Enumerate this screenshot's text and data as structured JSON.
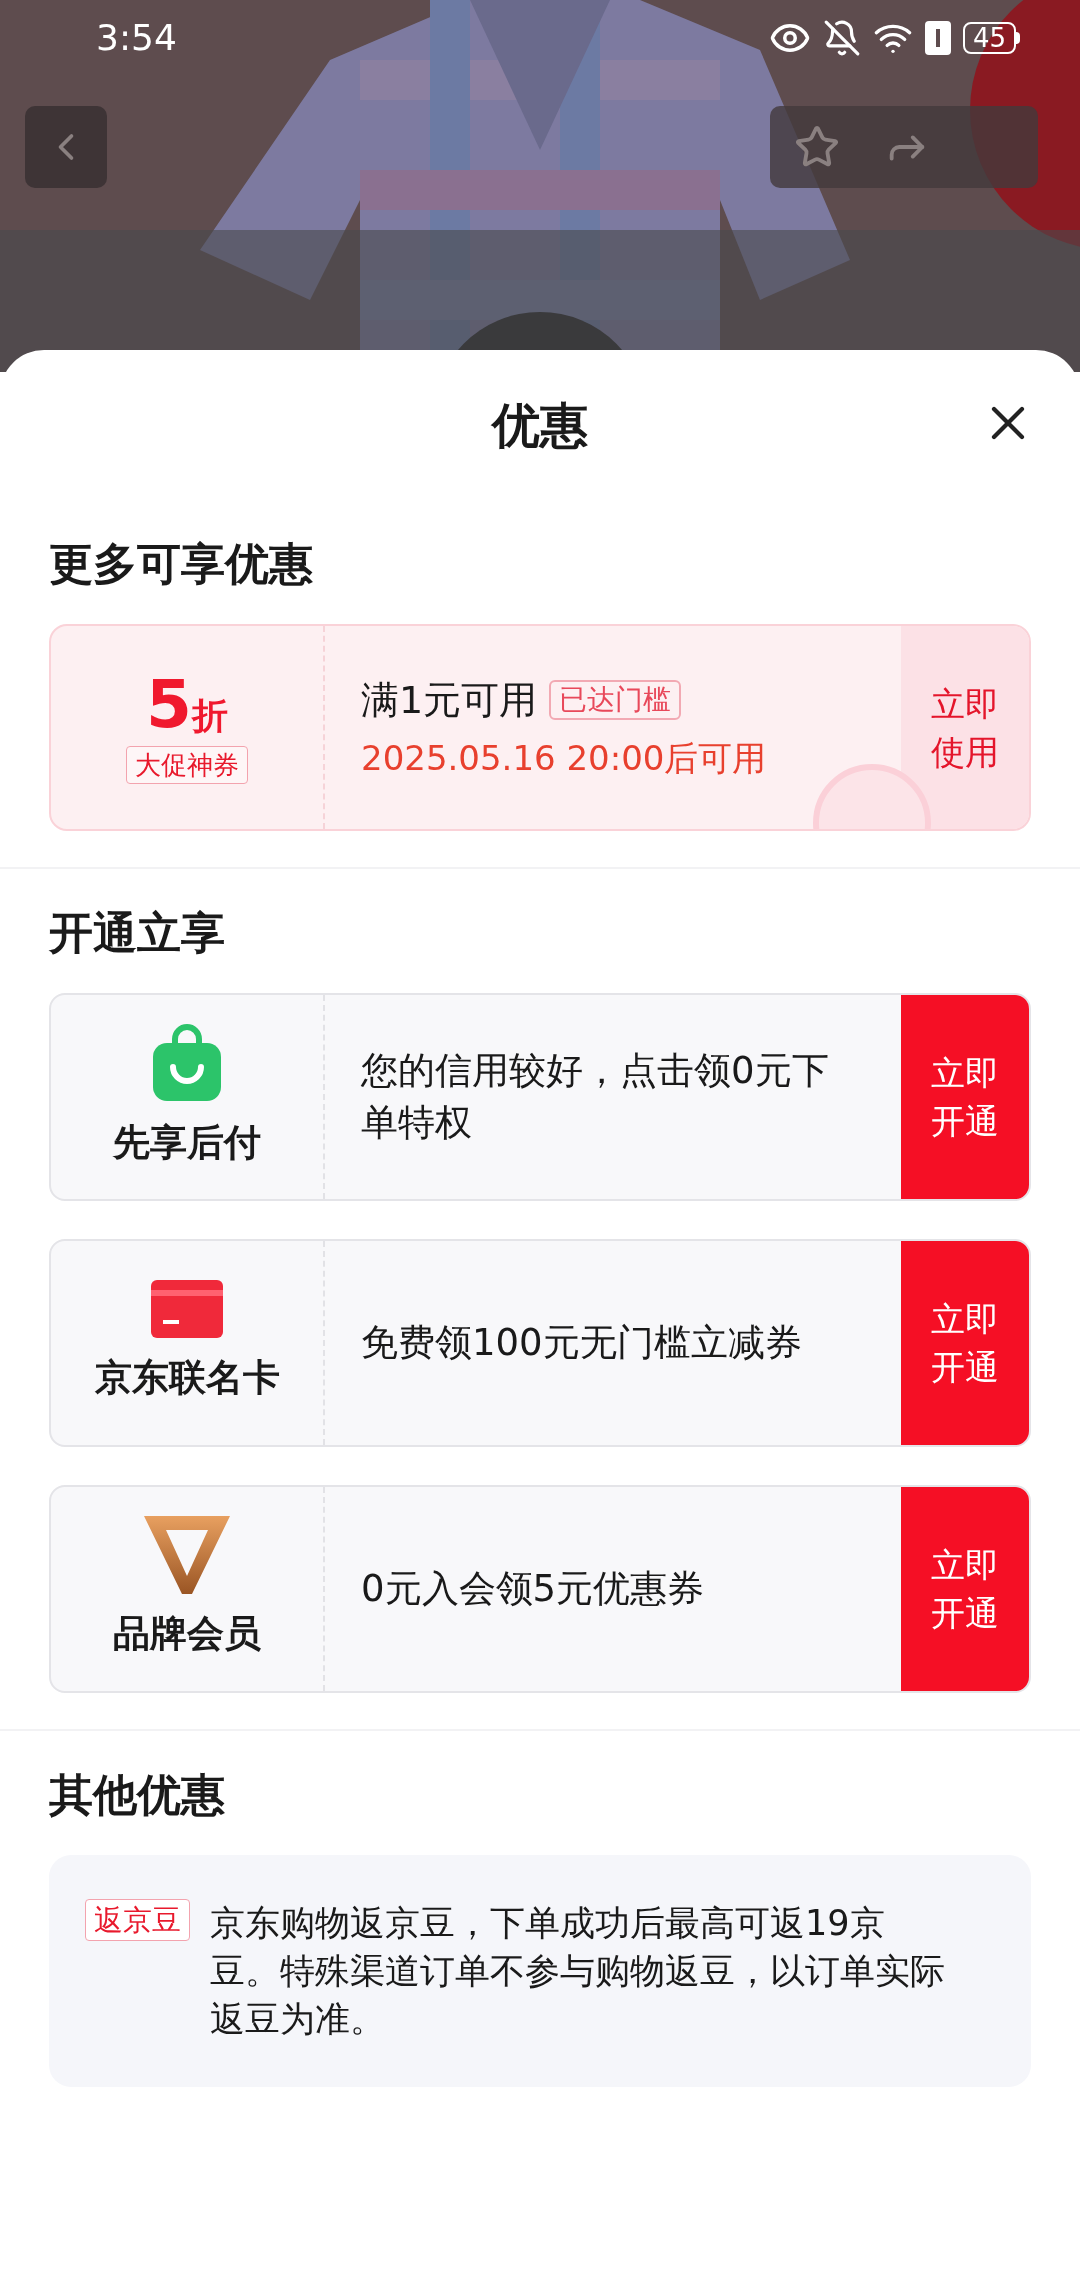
{
  "status_bar": {
    "time": "3:54",
    "battery": "45"
  },
  "sheet": {
    "title": "优惠"
  },
  "sections": [
    {
      "kind": "coupons",
      "heading": "更多可享优惠",
      "items": [
        {
          "value": "5",
          "unit": "折",
          "tag": "大促神券",
          "condition": "满1元可用",
          "badge": "已达门槛",
          "validity": "2025.05.16 20:00后可用",
          "action": "立即使用",
          "claimed": true
        }
      ]
    },
    {
      "kind": "services",
      "heading": "开通立享",
      "items": [
        {
          "kind": "bag",
          "name": "先享后付",
          "description": "您的信用较好，点击领0元下单特权",
          "action": "立即开通"
        },
        {
          "kind": "card",
          "name": "京东联名卡",
          "description": "免费领100元无门槛立减券",
          "action": "立即开通"
        },
        {
          "kind": "v",
          "name": "品牌会员",
          "description": "0元入会领5元优惠券",
          "action": "立即开通"
        }
      ]
    },
    {
      "kind": "rebates",
      "heading": "其他优惠",
      "items": [
        {
          "tag": "返京豆",
          "text": "京东购物返京豆，下单成功后最高可返19京豆。特殊渠道订单不参与购物返豆，以订单实际返豆为准。"
        }
      ]
    }
  ]
}
